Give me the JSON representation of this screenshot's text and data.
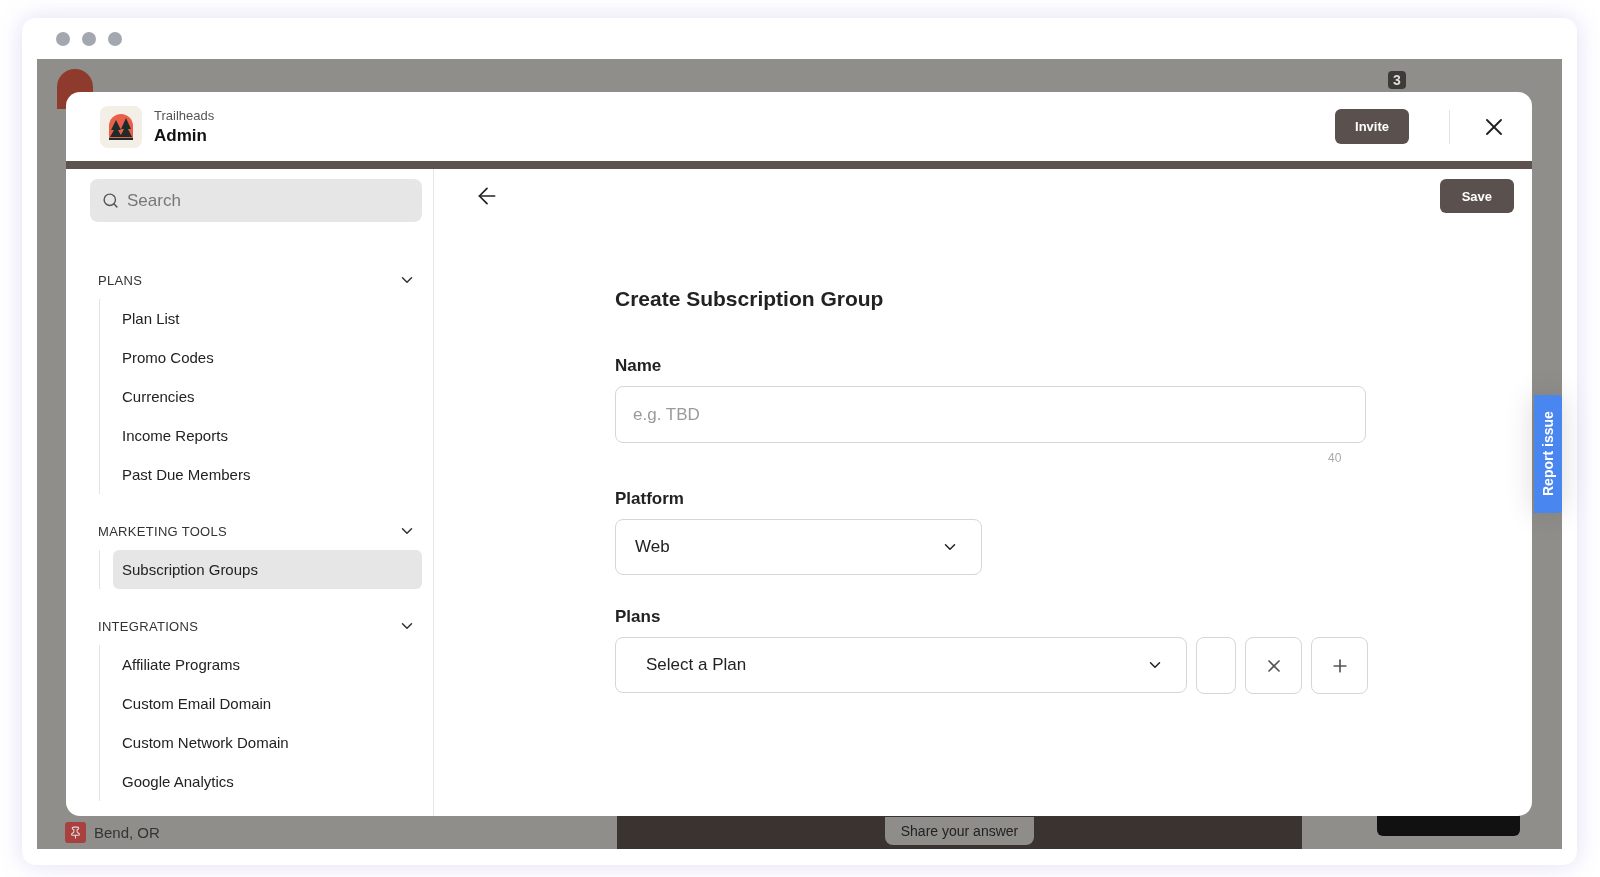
{
  "background_app": {
    "badge": "3",
    "location": "Bend, OR",
    "share_button": "Share your answer"
  },
  "modal": {
    "org": "Trailheads",
    "title": "Admin",
    "invite_button": "Invite"
  },
  "sidebar": {
    "search": {
      "placeholder": "Search"
    },
    "sections": [
      {
        "title": "PLANS",
        "expanded": true,
        "items": [
          {
            "label": "Plan List",
            "selected": false
          },
          {
            "label": "Promo Codes",
            "selected": false
          },
          {
            "label": "Currencies",
            "selected": false
          },
          {
            "label": "Income Reports",
            "selected": false
          },
          {
            "label": "Past Due Members",
            "selected": false
          }
        ]
      },
      {
        "title": "MARKETING TOOLS",
        "expanded": true,
        "items": [
          {
            "label": "Subscription Groups",
            "selected": true
          }
        ]
      },
      {
        "title": "INTEGRATIONS",
        "expanded": true,
        "items": [
          {
            "label": "Affiliate Programs",
            "selected": false
          },
          {
            "label": "Custom Email Domain",
            "selected": false
          },
          {
            "label": "Custom Network Domain",
            "selected": false
          },
          {
            "label": "Google Analytics",
            "selected": false
          }
        ]
      }
    ]
  },
  "form": {
    "save_button": "Save",
    "title": "Create Subscription Group",
    "fields": [
      {
        "kind": "text",
        "label": "Name",
        "placeholder": "e.g. TBD",
        "counter": "40"
      },
      {
        "kind": "select",
        "label": "Platform",
        "value": "Web"
      },
      {
        "kind": "plan_select",
        "label": "Plans",
        "value": "Select a Plan"
      }
    ]
  },
  "report_tab": "Report issue"
}
